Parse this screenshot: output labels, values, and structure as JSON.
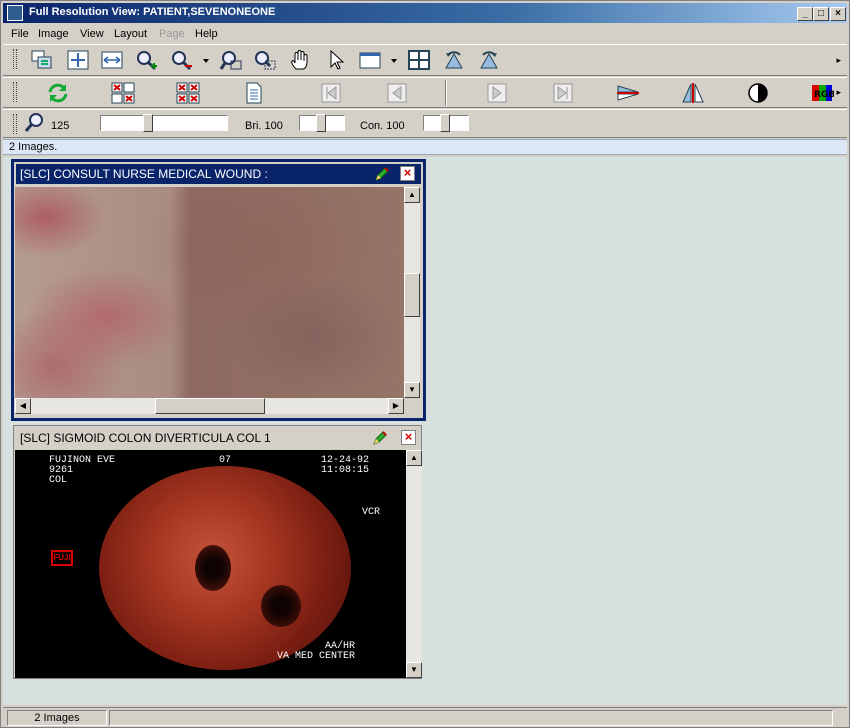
{
  "window": {
    "title": "Full Resolution View: PATIENT,SEVENONEONE"
  },
  "menu": [
    "File",
    "Image",
    "View",
    "Layout",
    "Page",
    "Help"
  ],
  "toolbar1": {
    "icons": [
      "copy-images-icon",
      "fit-to-window-icon",
      "fit-width-icon",
      "zoom-in-icon",
      "zoom-out-icon",
      "zoom-dropdown-icon",
      "zoom-window-icon",
      "zoom-rect-icon",
      "pan-hand-icon",
      "pointer-icon",
      "layout-window-icon",
      "layout-dropdown-icon",
      "grid-layout-icon",
      "rotate-left-icon",
      "rotate-right-icon"
    ]
  },
  "toolbar2": {
    "icons": [
      "refresh-icon",
      "close-selected-icon",
      "close-all-icon",
      "report-icon",
      "first-page-icon",
      "previous-page-icon",
      "next-page-icon",
      "last-page-icon",
      "flip-horizontal-icon",
      "mirror-icon",
      "invert-icon",
      "rgb-icon"
    ]
  },
  "toolbar3": {
    "zoom_value": "125",
    "brightness_label": "Bri. 100",
    "contrast_label": "Con. 100"
  },
  "images_info": "2 Images.",
  "panels": [
    {
      "title": "[SLC] CONSULT NURSE MEDICAL WOUND :",
      "active": true
    },
    {
      "title": "[SLC] SIGMOID COLON DIVERTICULA COL 1",
      "active": false
    }
  ],
  "colon_overlay": {
    "top_left": "FUJINON EVE\n9261\nCOL",
    "top_mid": "07",
    "top_right": "12-24-92\n11:08:15",
    "right_mid": "VCR",
    "bottom_right": "AA/HR\nVA MED CENTER",
    "logo": "FUJI"
  },
  "statusbar": {
    "count": "2 Images"
  },
  "colors": {
    "title_active": "#0a246a",
    "content_bg": "#d5e0df",
    "images_bar": "#dbe7f5"
  }
}
